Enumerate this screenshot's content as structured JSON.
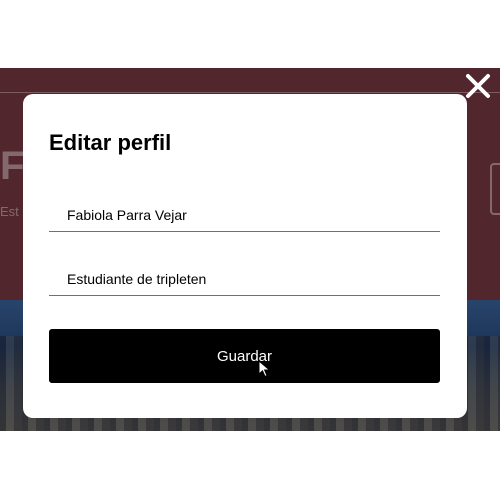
{
  "modal": {
    "title": "Editar perfil",
    "name_value": "Fabiola Parra Vejar",
    "about_value": "Estudiante de tripleten",
    "save_label": "Guardar"
  },
  "background": {
    "heading_fragment": "F",
    "sub_fragment": "Est"
  },
  "icons": {
    "close": "close-icon",
    "cursor": "mouse-pointer-icon"
  },
  "colors": {
    "page_bg": "#7d3b46",
    "button_bg": "#000000",
    "button_text": "#ffffff"
  }
}
